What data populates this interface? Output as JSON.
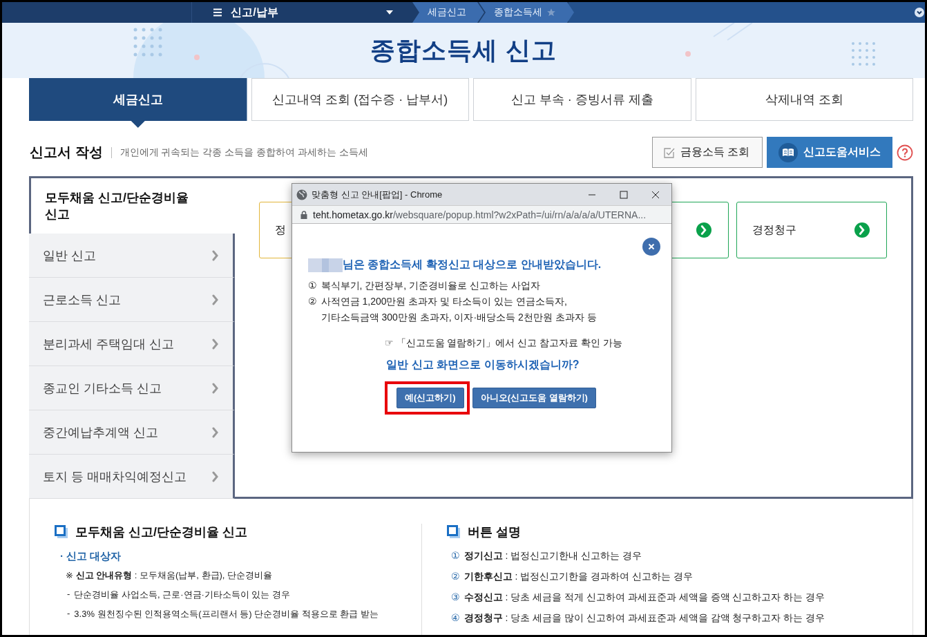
{
  "nav": {
    "menu_label": "신고/납부",
    "breadcrumb": [
      {
        "label": "세금신고",
        "starred": false
      },
      {
        "label": "종합소득세",
        "starred": true
      }
    ]
  },
  "page_title": "종합소득세 신고",
  "tabs": [
    {
      "label": "세금신고",
      "selected": true
    },
    {
      "label": "신고내역 조회 (접수증 · 납부서)",
      "selected": false
    },
    {
      "label": "신고 부속 · 증빙서류 제출",
      "selected": false
    },
    {
      "label": "삭제내역 조회",
      "selected": false
    }
  ],
  "section": {
    "title": "신고서 작성",
    "description": "개인에게 귀속되는 각종 소득을 종합하여 과세하는 소득세",
    "buttons": [
      {
        "label": "금융소득 조회",
        "kind": "outline"
      },
      {
        "label": "신고도움서비스",
        "kind": "primary"
      }
    ]
  },
  "side_menu": [
    {
      "label": "모두채움 신고/단순경비율 신고",
      "selected": true
    },
    {
      "label": "일반 신고",
      "selected": false
    },
    {
      "label": "근로소득 신고",
      "selected": false
    },
    {
      "label": "분리과세 주택임대 신고",
      "selected": false
    },
    {
      "label": "종교인 기타소득 신고",
      "selected": false
    },
    {
      "label": "중간예납추계액 신고",
      "selected": false
    },
    {
      "label": "토지 등 매매차익예정신고",
      "selected": false
    }
  ],
  "cards": [
    {
      "label": "정",
      "color": "#e2b53a"
    },
    {
      "color": "#1fa656"
    },
    {
      "label": "경정청구",
      "color": "#1fa656"
    }
  ],
  "info_left": {
    "heading": "모두채움 신고/단순경비율 신고",
    "sub_mark": "·",
    "item_mark": "-",
    "subheading": "신고 대상자",
    "note": "**신고 안내유형** : 모두채움(납부, 환급), 단순경비율",
    "note_mark": "※",
    "items": [
      "단순경비율 사업소득, 근로·연금·기타소득이 있는 경우",
      "3.3% 원천징수된 인적용역소득(프리랜서 등) 단순경비율 적용으로 환급 받는"
    ]
  },
  "info_right": {
    "heading": "버튼 설명",
    "items": [
      {
        "num": "①",
        "term": "정기신고",
        "text": " : 법정신고기한내 신고하는 경우"
      },
      {
        "num": "②",
        "term": "기한후신고",
        "text": " : 법정신고기한을 경과하여 신고하는 경우"
      },
      {
        "num": "③",
        "term": "수정신고",
        "text": " : 당초 세금을 적게 신고하여 과세표준과 세액을 증액 신고하고자 하는 경우"
      },
      {
        "num": "④",
        "term": "경정청구",
        "text": " : 당초 세금을 많이 신고하여 과세표준과 세액을 감액 청구하고자 하는 경우"
      }
    ]
  },
  "popup": {
    "window_title": "맞춤형 신고 안내[팝업] - Chrome",
    "url_host": "teht.hometax.go.kr",
    "url_path": "/websquare/popup.html?w2xPath=/ui/rn/a/a/a/a/UTERNA...",
    "message": "님은 종합소득세 확정신고 대상으로 안내받았습니다.",
    "items": [
      {
        "num": "①",
        "lines": [
          "복식부기, 간편장부, 기준경비율로 신고하는 사업자"
        ]
      },
      {
        "num": "②",
        "lines": [
          "사적연금 1,200만원 초과자 및 타소득이 있는 연금소득자,",
          "기타소득금액 300만원 초과자, 이자·배당소득 2천만원 초과자 등"
        ]
      }
    ],
    "hint_mark": "☞",
    "hint": "「신고도움 열람하기」에서 신고 참고자료 확인 가능",
    "question": "일반 신고 화면으로 이동하시겠습니까?",
    "buttons": [
      {
        "label": "예(신고하기)",
        "highlighted": true
      },
      {
        "label": "아니오(신고도움 열람하기)",
        "highlighted": false
      }
    ]
  }
}
